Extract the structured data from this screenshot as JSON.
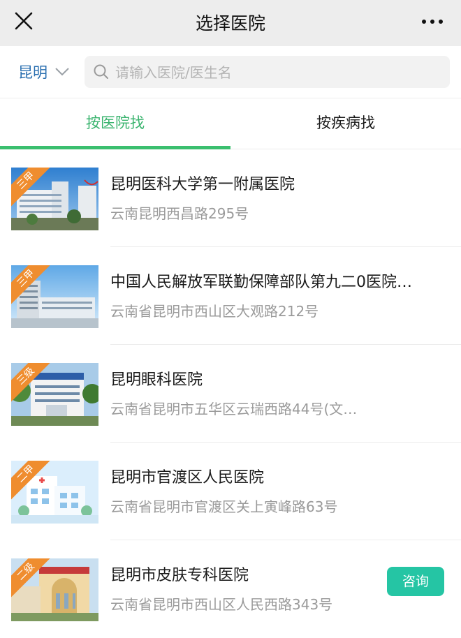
{
  "header": {
    "title": "选择医院",
    "close_icon": "close-icon",
    "more_icon": "more-icon"
  },
  "search": {
    "city": "昆明",
    "placeholder": "请输入医院/医生名"
  },
  "tabs": [
    {
      "label": "按医院找",
      "active": true
    },
    {
      "label": "按疾病找",
      "active": false
    }
  ],
  "colors": {
    "accent": "#3bbf6f",
    "city": "#2a6fb0",
    "badge": "#ef8d2f",
    "consult": "#25c5a4",
    "header_bg": "#ededed"
  },
  "hospitals": [
    {
      "name": "昆明医科大学第一附属医院",
      "address": "云南昆明西昌路295号",
      "level": "三甲"
    },
    {
      "name": "中国人民解放军联勤保障部队第九二0医院…",
      "address": "云南省昆明市西山区大观路212号",
      "level": "三甲"
    },
    {
      "name": "昆明眼科医院",
      "address": "云南省昆明市五华区云瑞西路44号(文…",
      "level": "三级"
    },
    {
      "name": "昆明市官渡区人民医院",
      "address": "云南省昆明市官渡区关上寅峰路63号",
      "level": "二甲"
    },
    {
      "name": "昆明市皮肤专科医院",
      "address": "云南省昆明市西山区人民西路343号",
      "level": "二级",
      "action": "咨询"
    }
  ]
}
